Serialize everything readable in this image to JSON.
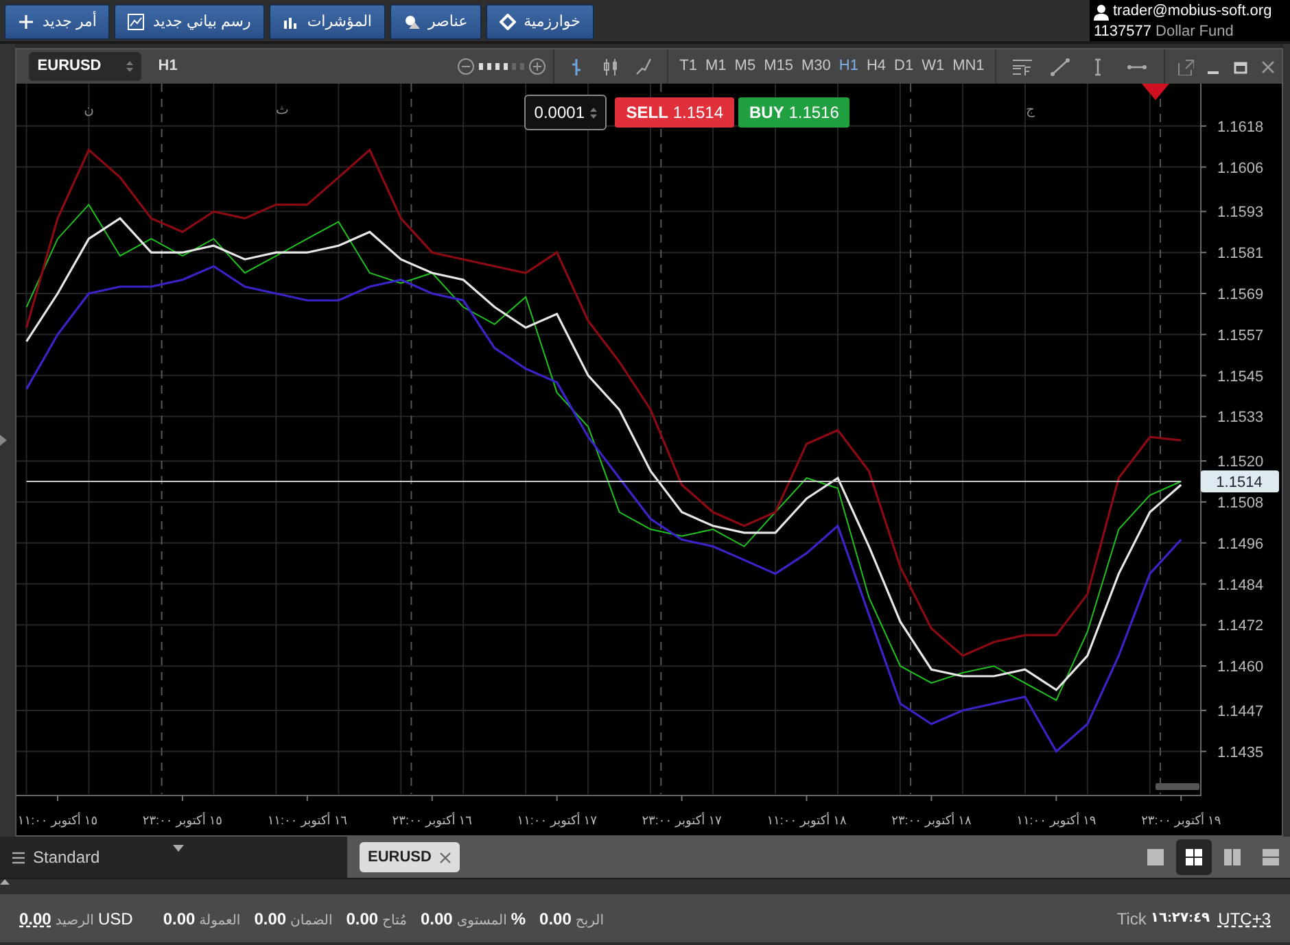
{
  "toolbar": {
    "buttons": [
      {
        "label": "خوارزمية",
        "kind": "diamond"
      },
      {
        "label": "عناصر",
        "kind": "shapes"
      },
      {
        "label": "المؤشرات",
        "kind": "bars"
      },
      {
        "label": "رسم بياني جديد",
        "kind": "chart"
      },
      {
        "label": "أمر جديد",
        "kind": "plus"
      }
    ],
    "account": {
      "user": "trader@mobius-soft.org",
      "number": "1137577",
      "name": "Dollar Fund"
    }
  },
  "chart_window": {
    "symbol": "EURUSD",
    "timeframe_label": "H1",
    "zoom": {
      "level": 0.67
    },
    "chart_types": [
      {
        "kind": "bars",
        "selected": true
      },
      {
        "kind": "candles",
        "selected": false
      },
      {
        "kind": "line",
        "selected": false
      }
    ],
    "timeframes": [
      {
        "label": "MN1",
        "selected": false
      },
      {
        "label": "W1",
        "selected": false
      },
      {
        "label": "D1",
        "selected": false
      },
      {
        "label": "H4",
        "selected": false
      },
      {
        "label": "H1",
        "selected": true
      },
      {
        "label": "M30",
        "selected": false
      },
      {
        "label": "M15",
        "selected": false
      },
      {
        "label": "M5",
        "selected": false
      },
      {
        "label": "M1",
        "selected": false
      },
      {
        "label": "T1",
        "selected": false
      }
    ],
    "tools": [
      {
        "kind": "indicator"
      },
      {
        "kind": "trendline"
      },
      {
        "kind": "vline"
      },
      {
        "kind": "hline"
      }
    ],
    "window_controls": [
      {
        "kind": "popout"
      },
      {
        "kind": "minimize"
      },
      {
        "kind": "maximize"
      },
      {
        "kind": "close"
      }
    ],
    "trade_panel": {
      "lot": "0.0001",
      "sell": {
        "label": "SELL",
        "price": "1.1514"
      },
      "buy": {
        "label": "BUY",
        "price": "1.1516"
      }
    },
    "day_labels": [
      "ج",
      "ث",
      "ن"
    ],
    "chart_data": {
      "type": "line",
      "categories": [
        null,
        "١٥ أكتوبر ١١:٠٠",
        null,
        null,
        null,
        "١٥ أكتوبر ٢٣:٠٠",
        null,
        null,
        null,
        "١٦ أكتوبر ١١:٠٠",
        null,
        null,
        null,
        "١٦ أكتوبر ٢٣:٠٠",
        null,
        null,
        null,
        "١٧ أكتوبر ١١:٠٠",
        null,
        null,
        null,
        "١٧ أكتوبر ٢٣:٠٠",
        null,
        null,
        null,
        "١٨ أكتوبر ١١:٠٠",
        null,
        null,
        null,
        "١٨ أكتوبر ٢٣:٠٠",
        null,
        null,
        null,
        "١٩ أكتوبر ١١:٠٠",
        null,
        null,
        null,
        "١٩ أكتوبر ٢٣:٠٠"
      ],
      "series": [
        {
          "color": "#1fc21f",
          "values": [
            1.1565,
            1.1585,
            1.1595,
            1.158,
            1.1585,
            1.158,
            1.1585,
            1.1575,
            1.158,
            1.1585,
            1.159,
            1.1575,
            1.1572,
            1.1575,
            1.1565,
            1.156,
            1.1568,
            1.154,
            1.153,
            1.1505,
            1.15,
            1.1498,
            1.15,
            1.1495,
            1.1505,
            1.1515,
            1.1512,
            1.148,
            1.146,
            1.1455,
            1.1458,
            1.146,
            1.1455,
            1.145,
            1.147,
            1.15,
            1.151,
            1.1514
          ]
        },
        {
          "color": "#8b0a14",
          "values": [
            1.1559,
            1.1591,
            1.1611,
            1.1603,
            1.1591,
            1.1587,
            1.1593,
            1.1591,
            1.1595,
            1.1595,
            1.1603,
            1.1611,
            1.1591,
            1.1581,
            1.1579,
            1.1577,
            1.1575,
            1.1581,
            1.1561,
            1.1549,
            1.1535,
            1.1513,
            1.1505,
            1.1501,
            1.1505,
            1.1525,
            1.1529,
            1.1517,
            1.1489,
            1.1471,
            1.1463,
            1.1467,
            1.1469,
            1.1469,
            1.1481,
            1.1515,
            1.1527,
            1.1526
          ]
        },
        {
          "color": "#e8e8e8",
          "values": [
            1.1555,
            1.1569,
            1.1585,
            1.1591,
            1.1581,
            1.1581,
            1.1583,
            1.1579,
            1.1581,
            1.1581,
            1.1583,
            1.1587,
            1.1579,
            1.1575,
            1.1573,
            1.1565,
            1.1559,
            1.1563,
            1.1545,
            1.1535,
            1.1517,
            1.1505,
            1.1501,
            1.1499,
            1.1499,
            1.1509,
            1.1515,
            1.1495,
            1.1473,
            1.1459,
            1.1457,
            1.1457,
            1.1459,
            1.1453,
            1.1463,
            1.1487,
            1.1505,
            1.1513
          ]
        },
        {
          "color": "#3a24c8",
          "values": [
            1.1541,
            1.1557,
            1.1569,
            1.1571,
            1.1571,
            1.1573,
            1.1577,
            1.1571,
            1.1569,
            1.1567,
            1.1567,
            1.1571,
            1.1573,
            1.1569,
            1.1567,
            1.1553,
            1.1547,
            1.1543,
            1.1527,
            1.1515,
            1.1503,
            1.1497,
            1.1495,
            1.1491,
            1.1487,
            1.1493,
            1.1501,
            1.1475,
            1.1449,
            1.1443,
            1.1447,
            1.1449,
            1.1451,
            1.1435,
            1.1443,
            1.1463,
            1.1487,
            1.1497
          ]
        },
        {
          "color": "#cccccc",
          "values": [
            1.1514,
            1.1514,
            1.1514,
            1.1514,
            1.1514,
            1.1514,
            1.1514,
            1.1514,
            1.1514,
            1.1514,
            1.1514,
            1.1514,
            1.1514,
            1.1514,
            1.1514,
            1.1514,
            1.1514,
            1.1514,
            1.1514,
            1.1514,
            1.1514,
            1.1514,
            1.1514,
            1.1514,
            1.1514,
            1.1514,
            1.1514,
            1.1514,
            1.1514,
            1.1514,
            1.1514,
            1.1514,
            1.1514,
            1.1514,
            1.1514,
            1.1514,
            1.1514,
            1.1514
          ]
        }
      ],
      "ylim": [
        1.14225,
        1.16304
      ],
      "yticks": [
        {
          "value": 1.1618,
          "label": "1.1618"
        },
        {
          "value": 1.1606,
          "label": "1.1606"
        },
        {
          "value": 1.1593,
          "label": "1.1593"
        },
        {
          "value": 1.1581,
          "label": "1.1581"
        },
        {
          "value": 1.1569,
          "label": "1.1569"
        },
        {
          "value": 1.1557,
          "label": "1.1557"
        },
        {
          "value": 1.1545,
          "label": "1.1545"
        },
        {
          "value": 1.1533,
          "label": "1.1533"
        },
        {
          "value": 1.152,
          "label": "1.1520"
        },
        {
          "value": 1.1508,
          "label": "1.1508"
        },
        {
          "value": 1.1496,
          "label": "1.1496"
        },
        {
          "value": 1.1484,
          "label": "1.1484"
        },
        {
          "value": 1.1472,
          "label": "1.1472"
        },
        {
          "value": 1.146,
          "label": "1.1460"
        },
        {
          "value": 1.1447,
          "label": "1.1447"
        },
        {
          "value": 1.1435,
          "label": "1.1435"
        }
      ],
      "grid": true
    },
    "current_price": "1.1514"
  },
  "bottom_bar": {
    "layout_selector": "Standard",
    "tabs": [
      {
        "label": "EURUSD",
        "selected": true
      }
    ],
    "layout_buttons": [
      {
        "kind": "single",
        "selected": false
      },
      {
        "kind": "grid",
        "selected": true
      },
      {
        "kind": "columns",
        "selected": false
      },
      {
        "kind": "rows",
        "selected": false
      }
    ]
  },
  "status_bar": {
    "items": [
      {
        "value": "0.00",
        "label": "الربح"
      },
      {
        "value": "0.00",
        "label": "المستوى",
        "unit": "%"
      },
      {
        "value": "0.00",
        "label": "مُتاح"
      },
      {
        "value": "0.00",
        "label": "الضمان"
      },
      {
        "value": "0.00",
        "label": "العمولة"
      },
      {
        "value": "0.00",
        "label": "الرصيد",
        "unit": "USD"
      }
    ],
    "tick_label": "Tick",
    "time": "١٦:٢٧:٤٩",
    "timezone": "UTC+3"
  }
}
